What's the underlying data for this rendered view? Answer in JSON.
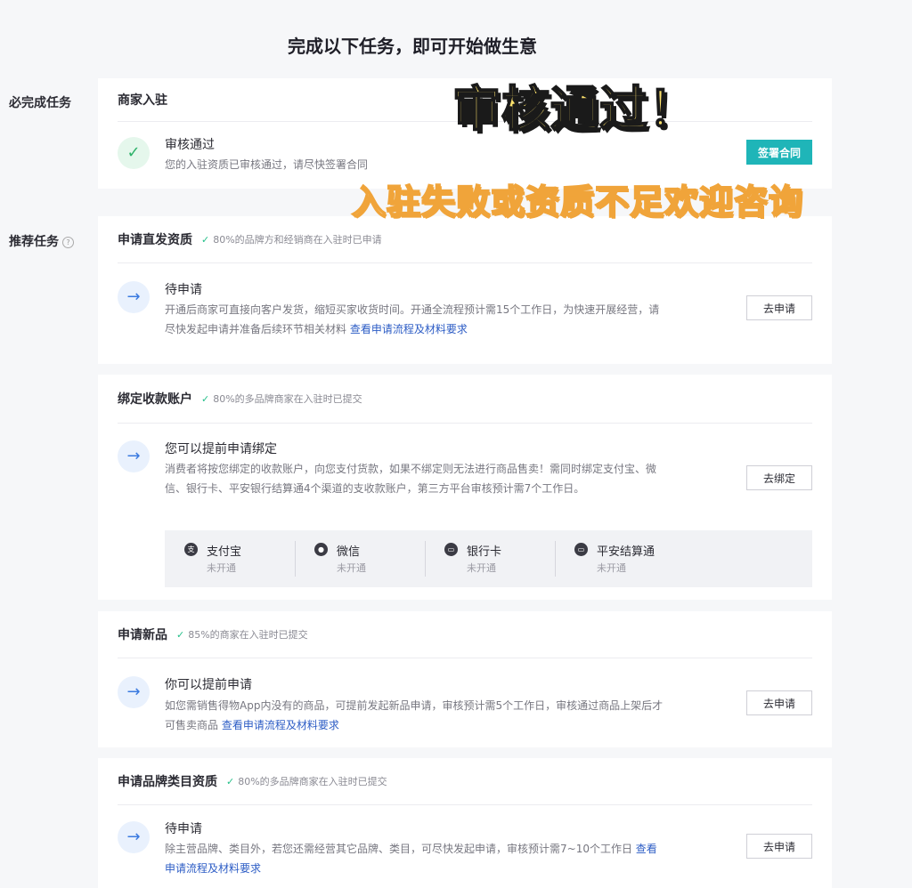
{
  "page": {
    "title": "完成以下任务，即可开始做生意"
  },
  "sections": {
    "required": "必完成任务",
    "recommended": "推荐任务"
  },
  "overlay": {
    "headline": "审核通过！",
    "subline": "入驻失败或资质不足欢迎咨询"
  },
  "cards": {
    "merchant": {
      "title": "商家入驻",
      "state": "审核通过",
      "desc": "您的入驻资质已审核通过，请尽快签署合同",
      "button": "签署合同"
    },
    "direct": {
      "title": "申请直发资质",
      "meta": "80%的品牌方和经销商在入驻时已申请",
      "state": "待申请",
      "desc": "开通后商家可直接向客户发货，缩短买家收货时间。开通全流程预计需15个工作日，为快速开展经营，请尽快发起申请并准备后续环节相关材料",
      "link": "查看申请流程及材料要求",
      "button": "去申请"
    },
    "account": {
      "title": "绑定收款账户",
      "meta": "80%的多品牌商家在入驻时已提交",
      "state": "您可以提前申请绑定",
      "desc": "消费者将按您绑定的收款账户，向您支付货款，如果不绑定则无法进行商品售卖！需同时绑定支付宝、微信、银行卡、平安银行结算通4个渠道的支收款账户，第三方平台审核预计需7个工作日。",
      "button": "去绑定",
      "channels": [
        {
          "name": "支付宝",
          "status": "未开通",
          "icon": "alipay-icon"
        },
        {
          "name": "微信",
          "status": "未开通",
          "icon": "wechat-icon"
        },
        {
          "name": "银行卡",
          "status": "未开通",
          "icon": "bank-card-icon"
        },
        {
          "name": "平安结算通",
          "status": "未开通",
          "icon": "pingan-icon"
        }
      ]
    },
    "newproduct": {
      "title": "申请新品",
      "meta": "85%的商家在入驻时已提交",
      "state": "你可以提前申请",
      "desc": "如您需销售得物App内没有的商品，可提前发起新品申请，审核预计需5个工作日，审核通过商品上架后才可售卖商品",
      "link": "查看申请流程及材料要求",
      "button": "去申请"
    },
    "brand": {
      "title": "申请品牌类目资质",
      "meta": "80%的多品牌商家在入驻时已提交",
      "state": "待申请",
      "desc": "除主营品牌、类目外，若您还需经营其它品牌、类目，可尽快发起申请，审核预计需7~10个工作日",
      "link": "查看申请流程及材料要求",
      "button": "去申请"
    }
  }
}
